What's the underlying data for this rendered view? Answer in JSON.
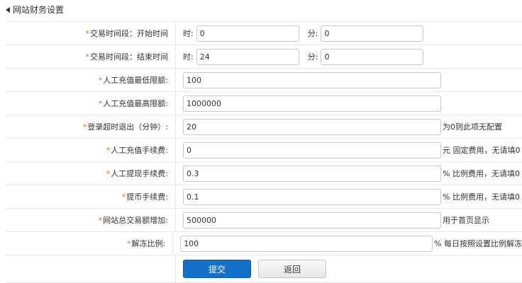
{
  "header": {
    "title": "网站财务设置",
    "icon": "tag-icon"
  },
  "form": {
    "required_mark": "*",
    "rows": [
      {
        "label": "交易时间段：开始时间",
        "hour_label": "时:",
        "hour_value": "0",
        "minute_label": "分:",
        "minute_value": "0"
      },
      {
        "label": "交易时间段：结束时间",
        "hour_label": "时:",
        "hour_value": "24",
        "minute_label": "分:",
        "minute_value": "0"
      },
      {
        "label": "人工充值最低限额:",
        "value": "100",
        "hint": ""
      },
      {
        "label": "人工充值最高限额:",
        "value": "1000000",
        "hint": ""
      },
      {
        "label": "登录超时退出（分钟）:",
        "value": "20",
        "hint": "为0则此项无配置"
      },
      {
        "label": "人工充值手续费:",
        "value": "0",
        "hint": "元   固定费用，无请填0"
      },
      {
        "label": "人工提现手续费:",
        "value": "0.3",
        "hint": "%   比例费用，无请填0"
      },
      {
        "label": "提币手续费:",
        "value": "0.1",
        "hint": "%   比例费用，无请填0"
      },
      {
        "label": "网站总交易额增加:",
        "value": "500000",
        "hint": "用于首页显示"
      },
      {
        "label": "解冻比例:",
        "value": "100",
        "hint": "%   每日按照设置比例解冻"
      }
    ]
  },
  "buttons": {
    "submit": "提交",
    "back": "返回"
  },
  "colors": {
    "required": "#e8692c",
    "primary": "#1571c8",
    "border": "#e6e6e6"
  }
}
